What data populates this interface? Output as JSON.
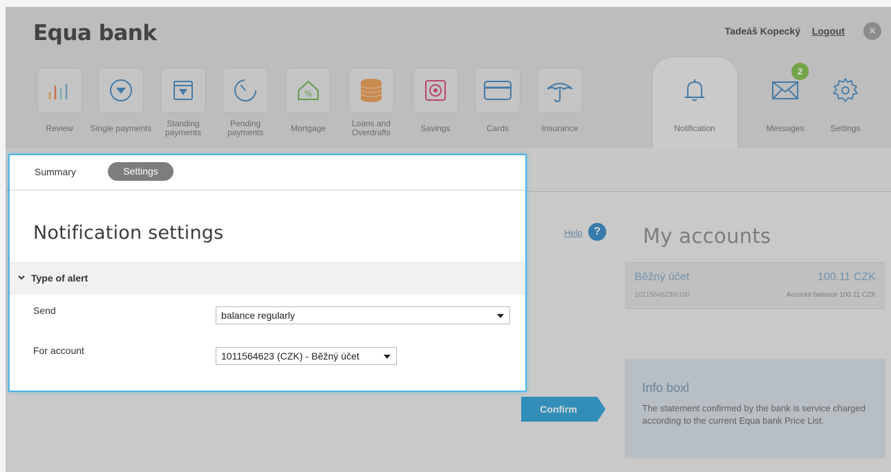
{
  "header": {
    "logo": "Equa bank",
    "user_name": "Tadeáš Kopecký",
    "logout_label": "Logout",
    "close_symbol": "×"
  },
  "nav": {
    "items": [
      {
        "label": "Review",
        "icon": "bar-chart-icon"
      },
      {
        "label": "Single payments",
        "icon": "single-payment-icon"
      },
      {
        "label": "Standing payments",
        "icon": "standing-payment-icon"
      },
      {
        "label": "Pending payments",
        "icon": "pending-payment-icon"
      },
      {
        "label": "Mortgage",
        "icon": "mortgage-icon"
      },
      {
        "label": "Loans and Overdrafts",
        "icon": "coins-icon"
      },
      {
        "label": "Savings",
        "icon": "safe-icon"
      },
      {
        "label": "Cards",
        "icon": "card-icon"
      },
      {
        "label": "Insurance",
        "icon": "umbrella-icon"
      },
      {
        "label": "Notification",
        "icon": "bell-icon"
      },
      {
        "label": "Messages",
        "icon": "envelope-icon"
      },
      {
        "label": "Settings",
        "icon": "gear-icon"
      }
    ],
    "messages_badge": "2"
  },
  "modal": {
    "tabs": {
      "summary": "Summary",
      "settings": "Settings"
    },
    "title": "Notification settings",
    "section": "Type of alert",
    "fields": {
      "send_label": "Send",
      "send_value": "balance regularly",
      "account_label": "For account",
      "account_value": "1011564623 (CZK) - Běžný účet"
    }
  },
  "help": {
    "label": "Help",
    "icon": "?"
  },
  "accounts": {
    "title": "My accounts",
    "items": [
      {
        "name": "Běžný účet",
        "amount": "100.11 CZK",
        "number": "1011564623/6100",
        "balance_text": "Account balance 100.11 CZK"
      }
    ]
  },
  "confirm_label": "Confirm",
  "infobox": {
    "title": "Info boxl",
    "text": "The statement confirmed by the bank is service charged according to the current Equa bank Price List."
  },
  "colors": {
    "accent_blue": "#49b5e6",
    "help_blue": "#2f88c6",
    "badge_green": "#7dbb46",
    "link_blue": "#7aa6c8"
  }
}
